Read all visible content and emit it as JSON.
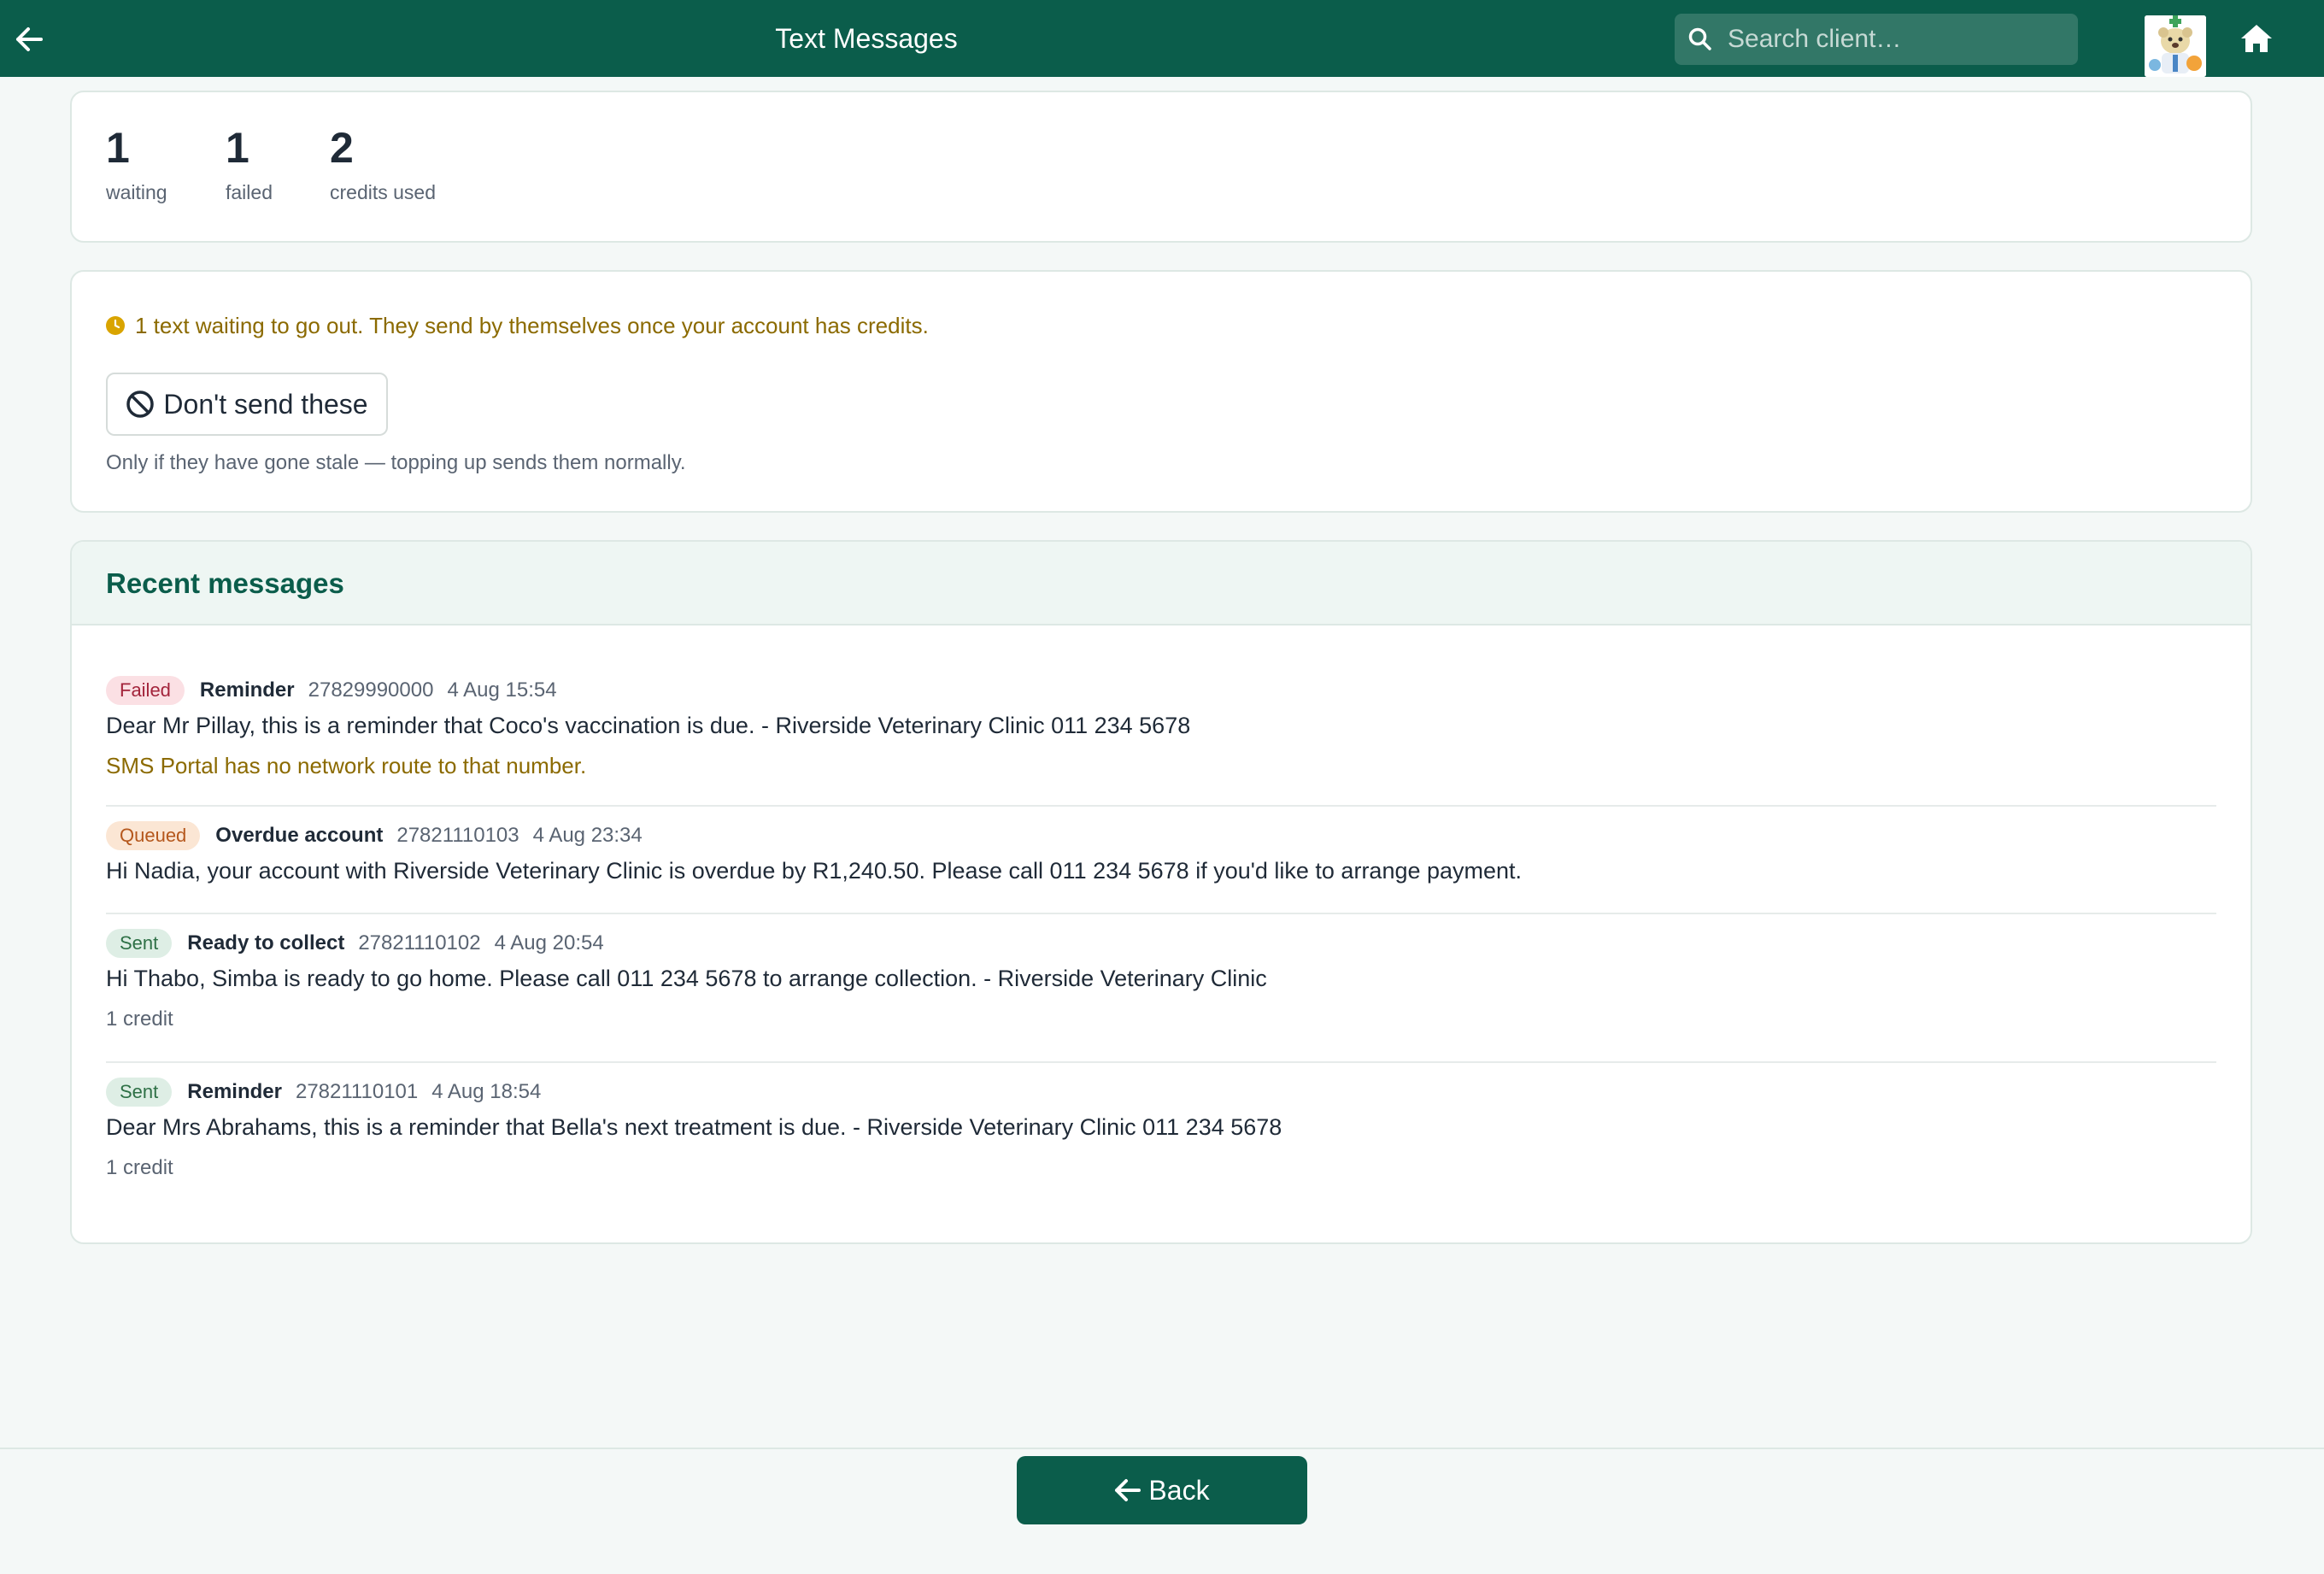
{
  "header": {
    "title": "Text Messages",
    "back_icon": "arrow-left-icon",
    "search_placeholder": "Search client…",
    "search_icon": "search-icon",
    "home_icon": "home-icon"
  },
  "stats": [
    {
      "value": "1",
      "label": "waiting"
    },
    {
      "value": "1",
      "label": "failed"
    },
    {
      "value": "2",
      "label": "credits used"
    }
  ],
  "notice": {
    "icon": "clock-icon",
    "message": "1 text waiting to go out. They send by themselves once your account has credits.",
    "button_label": "Don't send these",
    "button_icon": "block-icon",
    "hint": "Only if they have gone stale — topping up sends them normally."
  },
  "recent": {
    "title": "Recent messages",
    "messages": [
      {
        "status": "Failed",
        "type": "Reminder",
        "phone": "27829990000",
        "time": "4 Aug 15:54",
        "body": "Dear Mr Pillay, this is a reminder that Coco's vaccination is due. - Riverside Veterinary Clinic 011 234 5678",
        "error": "SMS Portal has no network route to that number."
      },
      {
        "status": "Queued",
        "type": "Overdue account",
        "phone": "27821110103",
        "time": "4 Aug 23:34",
        "body": "Hi Nadia, your account with Riverside Veterinary Clinic is overdue by R1,240.50. Please call 011 234 5678 if you'd like to arrange payment."
      },
      {
        "status": "Sent",
        "type": "Ready to collect",
        "phone": "27821110102",
        "time": "4 Aug 20:54",
        "body": "Hi Thabo, Simba is ready to go home. Please call 011 234 5678 to arrange collection. - Riverside Veterinary Clinic",
        "credit": "1 credit"
      },
      {
        "status": "Sent",
        "type": "Reminder",
        "phone": "27821110101",
        "time": "4 Aug 18:54",
        "body": "Dear Mrs Abrahams, this is a reminder that Bella's next treatment is due. - Riverside Veterinary Clinic 011 234 5678",
        "credit": "1 credit"
      }
    ]
  },
  "footer": {
    "back_label": "Back",
    "back_icon": "arrow-left-icon"
  },
  "colors": {
    "brand": "#0b5d4b",
    "failed": "#a3243b",
    "queued": "#b5571c",
    "sent": "#2e7046",
    "warning": "#8b6a00"
  }
}
